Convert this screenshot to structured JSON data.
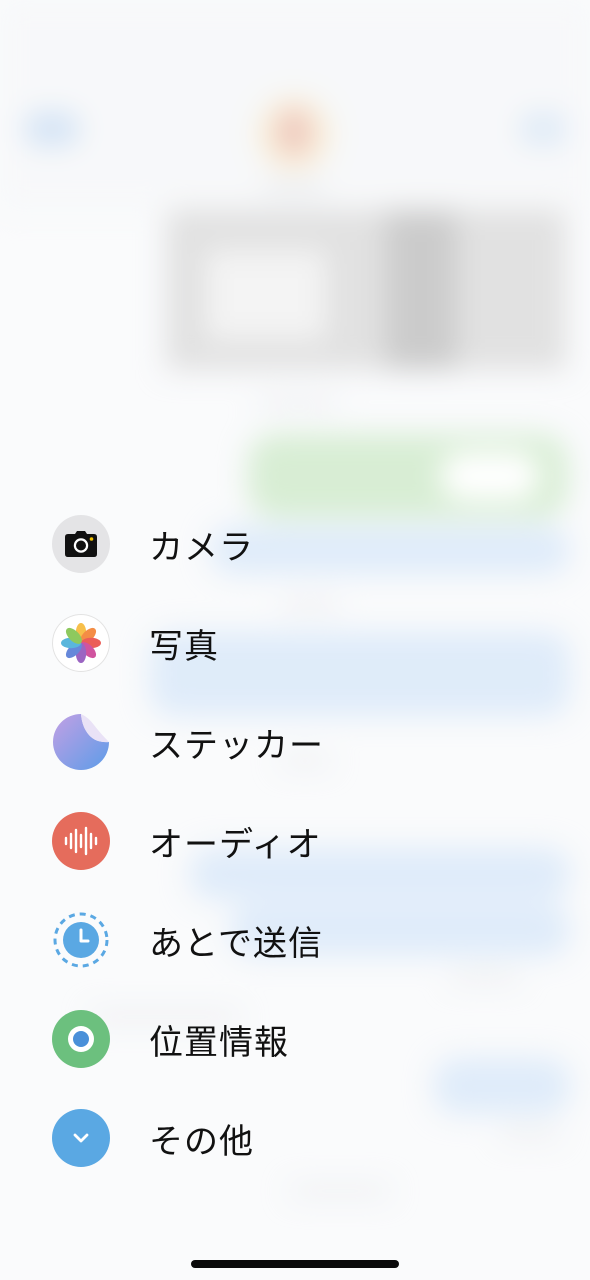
{
  "menu": {
    "items": [
      {
        "label": "カメラ",
        "icon": "camera-icon"
      },
      {
        "label": "写真",
        "icon": "photos-icon"
      },
      {
        "label": "ステッカー",
        "icon": "sticker-icon"
      },
      {
        "label": "オーディオ",
        "icon": "audio-waveform-icon"
      },
      {
        "label": "あとで送信",
        "icon": "clock-icon"
      },
      {
        "label": "位置情報",
        "icon": "location-icon"
      },
      {
        "label": "その他",
        "icon": "chevron-down-icon"
      }
    ]
  },
  "colors": {
    "audio": "#e56c5c",
    "location": "#6cc07e",
    "more": "#5aa8e3",
    "send_later": "#5aa8e3",
    "sticker_start": "#b49be6",
    "sticker_end": "#6aa3e6"
  }
}
